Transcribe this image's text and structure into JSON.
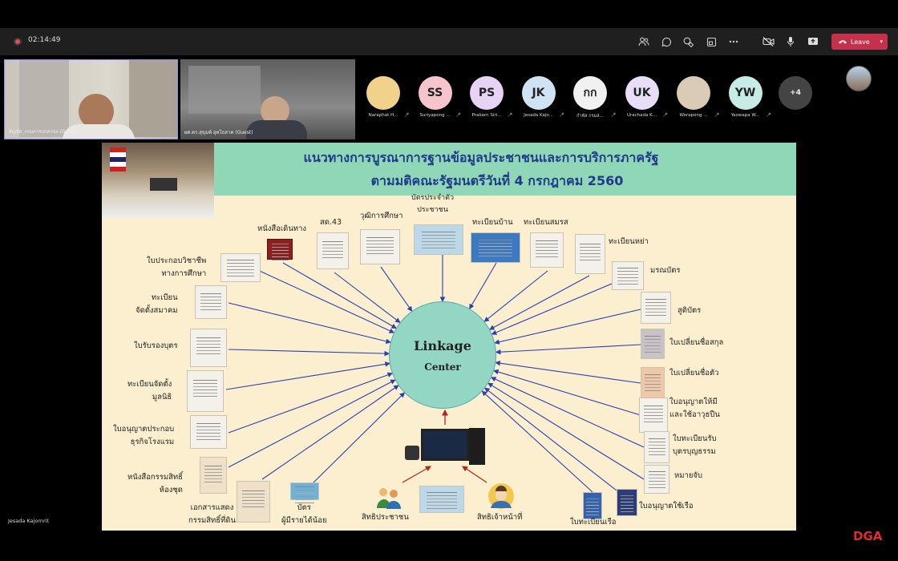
{
  "call": {
    "timer": "02:14:49",
    "leave_label": "Leave",
    "overflow_count": "+4",
    "bottom_speaker": "Jesada Kajornrit"
  },
  "video_tiles": [
    {
      "name": "สัญชัย_กรมการปกครอง (Guest)"
    },
    {
      "name": "ผศ.ดร.สุขุมพ์ อุทโธสาค (Guest)"
    }
  ],
  "participants": [
    {
      "initials": "",
      "name": "Naraphat H...",
      "color": "#f2d28a"
    },
    {
      "initials": "SS",
      "name": "Suriyapong ...",
      "color": "#f6c4cc"
    },
    {
      "initials": "PS",
      "name": "Prakarn Siri...",
      "color": "#e6d3f5"
    },
    {
      "initials": "JK",
      "name": "Jesada Kajo...",
      "color": "#cfe3f5"
    },
    {
      "initials": "กก",
      "name": "กำพัส กรมส...",
      "color": "#f1f1f1"
    },
    {
      "initials": "UK",
      "name": "Urachada K...",
      "color": "#e8def8"
    },
    {
      "initials": "",
      "name": "Worapong ...",
      "color": "#d9cbb6"
    },
    {
      "initials": "YW",
      "name": "Yaowapa W...",
      "color": "#c7ece6"
    }
  ],
  "slide": {
    "title_line1": "แนวทางการบูรณาการฐานข้อมูลประชาชนและการบริการภาครัฐ",
    "title_line2": "ตามมติคณะรัฐมนตรีวันที่ 4 กรกฎาคม 2560",
    "center_line1": "Linkage",
    "center_line2": "Center",
    "labels": {
      "passport": "หนังสือเดินทาง",
      "sd43": "สด.43",
      "education": "วุฒิการศึกษา",
      "idcard": "บัตรประจำตัว\nประชาชน",
      "house": "ทะเบียนบ้าน",
      "marriage": "ทะเบียนสมรส",
      "divorce": "ทะเบียนหย่า",
      "death": "มรณบัตร",
      "birth": "สูติบัตร",
      "surname": "ใบเปลี่ยนชื่อสกุล",
      "firstname": "ใบเปลี่ยนชื่อตัว",
      "gun": "ใบอนุญาตให้มี\nและใช้อาวุธปืน",
      "merit": "ใบทะเบียนรับ\nบุตรบุญธรรม",
      "warrant": "หมายจับ",
      "boatlicense": "ใบอนุญาตใช้เรือ",
      "boatreg": "ใบทะเบียนเรือ",
      "officer": "สิทธิเจ้าหน้าที่",
      "citizen": "สิทธิประชาชน",
      "lowincome": "บัตร\nผู้มีรายได้น้อย",
      "land": "เอกสารแสดง\nกรรมสิทธิ์ที่ดิน",
      "condo": "หนังสือกรรมสิทธิ์\nห้องชุด",
      "hotel": "ใบอนุญาตประกอบ\nธุรกิจโรงแรม",
      "foundation": "ทะเบียนจัดตั้ง\nมูลนิธิ",
      "adoption": "ใบรับรองบุตร",
      "association": "ทะเบียน\nจัดตั้งสมาคม",
      "teacher": "ใบประกอบวิชาชีพ\nทางการศึกษา"
    }
  },
  "brand": "DGA"
}
